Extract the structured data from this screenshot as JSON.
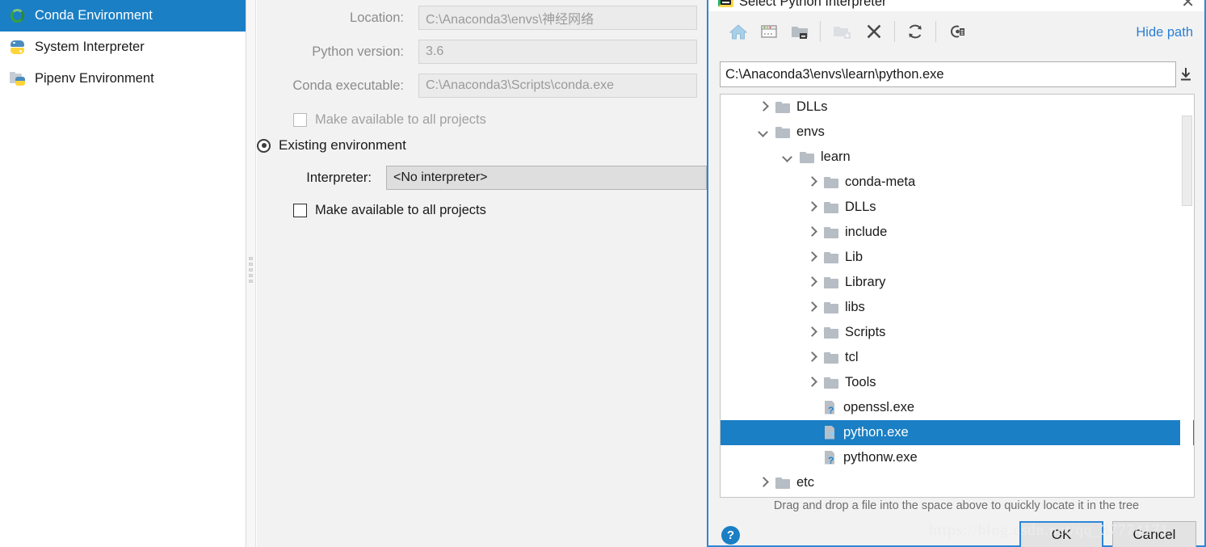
{
  "sidebar": {
    "items": [
      {
        "label": "Conda Environment",
        "icon": "conda-ring-icon",
        "selected": true
      },
      {
        "label": "System Interpreter",
        "icon": "python-logo-icon",
        "selected": false
      },
      {
        "label": "Pipenv Environment",
        "icon": "folder-python-icon",
        "selected": false
      }
    ]
  },
  "form": {
    "location_label": "Location:",
    "location_value": "C:\\Anaconda3\\envs\\神经网络",
    "python_version_label": "Python version:",
    "python_version_value": "3.6",
    "conda_executable_label": "Conda executable:",
    "conda_executable_value": "C:\\Anaconda3\\Scripts\\conda.exe",
    "make_available_new_label": "Make available to all projects",
    "existing_environment_label": "Existing environment",
    "interpreter_label": "Interpreter:",
    "interpreter_value": "<No interpreter>",
    "make_available_existing_label": "Make available to all projects"
  },
  "dialog": {
    "title": "Select Python Interpreter",
    "close_label": "✕",
    "hide_path_label": "Hide path",
    "path_value": "C:\\Anaconda3\\envs\\learn\\python.exe",
    "toolbar": [
      {
        "name": "home-icon",
        "title": "Home"
      },
      {
        "name": "desktop-icon",
        "title": "Desktop"
      },
      {
        "name": "project-folder-icon",
        "title": "Project Directory"
      },
      {
        "name": "new-folder-icon",
        "title": "New Folder"
      },
      {
        "name": "delete-icon",
        "title": "Delete"
      },
      {
        "name": "refresh-icon",
        "title": "Refresh"
      },
      {
        "name": "show-hidden-files-icon",
        "title": "Show Hidden Files"
      }
    ],
    "tree": [
      {
        "label": "DLLs",
        "indent": 1,
        "twisty": "right",
        "type": "folder",
        "selected": false
      },
      {
        "label": "envs",
        "indent": 1,
        "twisty": "down",
        "type": "folder",
        "selected": false
      },
      {
        "label": "learn",
        "indent": 2,
        "twisty": "down",
        "type": "folder",
        "selected": false
      },
      {
        "label": "conda-meta",
        "indent": 3,
        "twisty": "right",
        "type": "folder",
        "selected": false
      },
      {
        "label": "DLLs",
        "indent": 3,
        "twisty": "right",
        "type": "folder",
        "selected": false
      },
      {
        "label": "include",
        "indent": 3,
        "twisty": "right",
        "type": "folder",
        "selected": false
      },
      {
        "label": "Lib",
        "indent": 3,
        "twisty": "right",
        "type": "folder",
        "selected": false
      },
      {
        "label": "Library",
        "indent": 3,
        "twisty": "right",
        "type": "folder",
        "selected": false
      },
      {
        "label": "libs",
        "indent": 3,
        "twisty": "right",
        "type": "folder",
        "selected": false
      },
      {
        "label": "Scripts",
        "indent": 3,
        "twisty": "right",
        "type": "folder",
        "selected": false
      },
      {
        "label": "tcl",
        "indent": 3,
        "twisty": "right",
        "type": "folder",
        "selected": false
      },
      {
        "label": "Tools",
        "indent": 3,
        "twisty": "right",
        "type": "folder",
        "selected": false
      },
      {
        "label": "openssl.exe",
        "indent": 3,
        "twisty": "none",
        "type": "file",
        "selected": false
      },
      {
        "label": "python.exe",
        "indent": 3,
        "twisty": "none",
        "type": "file",
        "selected": true
      },
      {
        "label": "pythonw.exe",
        "indent": 3,
        "twisty": "none",
        "type": "file",
        "selected": false
      },
      {
        "label": "etc",
        "indent": 1,
        "twisty": "right",
        "type": "folder",
        "selected": false
      }
    ],
    "hint": "Drag and drop a file into the space above to quickly locate it in the tree",
    "help_label": "?",
    "ok_label": "OK",
    "cancel_label": "Cancel"
  },
  "watermark": {
    "text": "https://blog.csdn.net/qq_37774171"
  },
  "colors": {
    "accent": "#1a7fc4",
    "dialog_border": "#2e86d6",
    "link": "#2b7fd4",
    "panel_bg": "#f2f2f2"
  }
}
